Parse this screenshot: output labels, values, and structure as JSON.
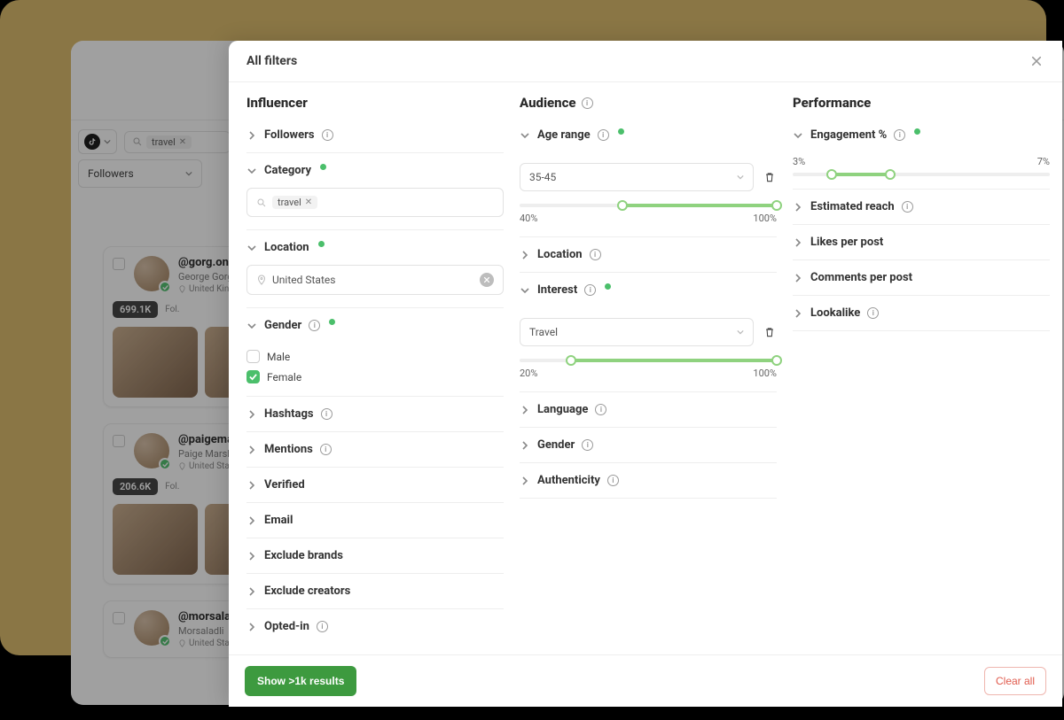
{
  "background": {
    "gold": "#8a7645"
  },
  "behind": {
    "search_tag": "travel",
    "dropdown_1": "Followers",
    "cards": [
      {
        "handle": "@gorg.on",
        "name": "George Gorg",
        "country": "United Kingdom",
        "followers": "699.1K",
        "follower_label": "Fol."
      },
      {
        "handle": "@paigemarshall",
        "name": "Paige Marshall",
        "country": "United States",
        "followers": "206.6K",
        "follower_label": "Fol."
      },
      {
        "handle": "@morsaladli",
        "name": "Morsaladli",
        "country": "United States",
        "followers": "",
        "follower_label": ""
      }
    ]
  },
  "modal": {
    "title": "All filters",
    "columns": {
      "influencer": {
        "title": "Influencer",
        "followers": "Followers",
        "category": "Category",
        "category_tag": "travel",
        "location": "Location",
        "location_value": "United States",
        "gender": "Gender",
        "gender_male": "Male",
        "gender_female": "Female",
        "hashtags": "Hashtags",
        "mentions": "Mentions",
        "verified": "Verified",
        "email": "Email",
        "exclude_brands": "Exclude brands",
        "exclude_creators": "Exclude creators",
        "opted_in": "Opted-in"
      },
      "audience": {
        "title": "Audience",
        "age_range": "Age range",
        "age_range_value": "35-45",
        "age_low": "40%",
        "age_high": "100%",
        "location": "Location",
        "interest": "Interest",
        "interest_value": "Travel",
        "interest_low": "20%",
        "interest_high": "100%",
        "language": "Language",
        "gender": "Gender",
        "authenticity": "Authenticity"
      },
      "performance": {
        "title": "Performance",
        "engagement": "Engagement %",
        "engagement_low": "3%",
        "engagement_high": "7%",
        "estimated_reach": "Estimated reach",
        "likes": "Likes per post",
        "comments": "Comments per post",
        "lookalike": "Lookalike"
      }
    },
    "footer": {
      "show_results": "Show >1k results",
      "clear_all": "Clear all"
    }
  }
}
